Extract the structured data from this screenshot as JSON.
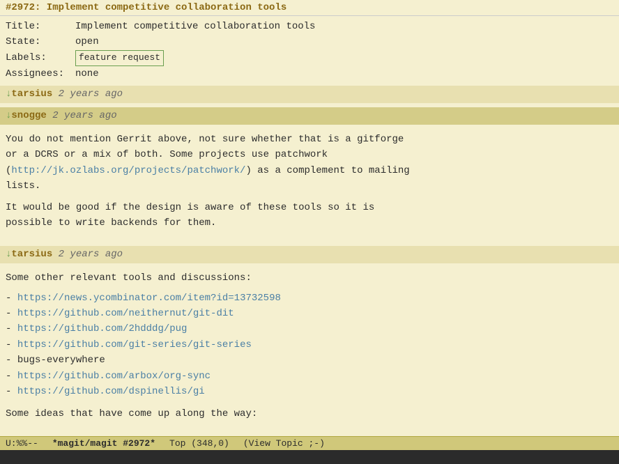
{
  "title": "#2972: Implement competitive collaboration tools",
  "issue": {
    "title_label": "Title:",
    "title_value": "Implement competitive collaboration tools",
    "state_label": "State:",
    "state_value": "open",
    "labels_label": "Labels:",
    "labels_value": "feature request",
    "assignees_label": "Assignees:",
    "assignees_value": "none"
  },
  "comments": [
    {
      "arrow": "↓",
      "author": "tarsius",
      "time": "2 years ago",
      "highlighted": false,
      "body": ""
    },
    {
      "arrow": "↓",
      "author": "snogge",
      "time": "2 years ago",
      "highlighted": true,
      "body_lines": [
        "You do not mention Gerrit above, not sure whether that is a gitforge",
        "or a DCRS or a mix of both.  Some projects use patchwork",
        "",
        "as a complement to mailing",
        "lists.",
        "",
        "",
        "It would be good if the design is aware of these tools so it is",
        "possible to write backends for them."
      ],
      "link_text": "http://jk.ozlabs.org/projects/patchwork/",
      "link_url": "http://jk.ozlabs.org/projects/patchwork/"
    },
    {
      "arrow": "↓",
      "author": "tarsius",
      "time": "2 years ago",
      "highlighted": false,
      "intro": "Some other relevant tools and discussions:",
      "list_items": [
        {
          "text": "https://news.ycombinator.com/item?id=13732598",
          "url": "https://news.ycombinator.com/item?id=13732598"
        },
        {
          "text": "https://github.com/neithernut/git-dit",
          "url": "https://github.com/neithernut/git-dit"
        },
        {
          "text": "https://github.com/2hdddg/pug",
          "url": "https://github.com/2hdddg/pug"
        },
        {
          "text": "https://github.com/git-series/git-series",
          "url": "https://github.com/git-series/git-series"
        },
        {
          "text": "bugs-everywhere",
          "url": null
        },
        {
          "text": "https://github.com/arbox/org-sync",
          "url": "https://github.com/arbox/org-sync"
        },
        {
          "text": "https://github.com/dspinellis/gi",
          "url": "https://github.com/dspinellis/gi"
        }
      ],
      "outro": "Some ideas that have come up along the way:"
    }
  ],
  "statusbar": {
    "mode": "U:%%--",
    "filename": "*magit/magit #2972*",
    "position": "Top (348,0)",
    "extra": "(View Topic ;-)"
  }
}
